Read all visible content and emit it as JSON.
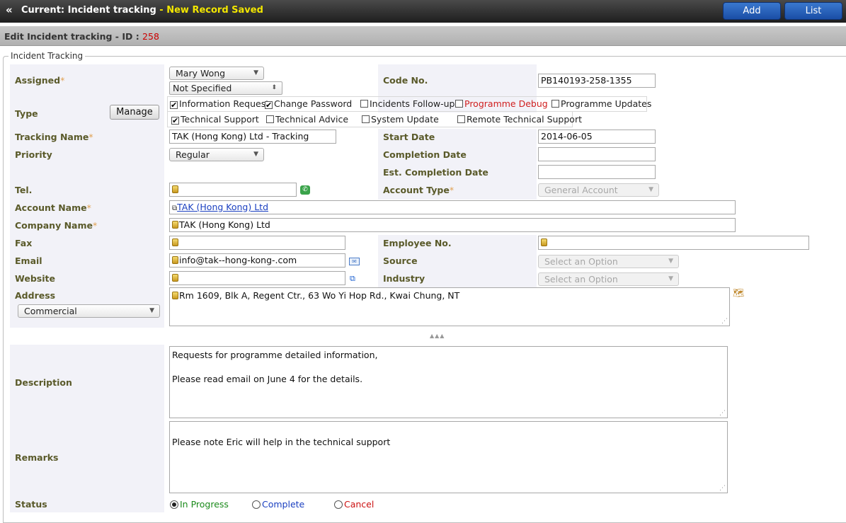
{
  "header": {
    "title": "Current: Incident tracking",
    "saved_message": " - New Record Saved",
    "add_label": "Add",
    "list_label": "List"
  },
  "subheader": {
    "label": "Edit Incident tracking - ID : ",
    "id": "258"
  },
  "fieldset": {
    "legend": "Incident Tracking"
  },
  "labels": {
    "assigned": "Assigned",
    "code_no": "Code No.",
    "type": "Type",
    "tracking_name": "Tracking Name",
    "start_date": "Start Date",
    "priority": "Priority",
    "completion_date": "Completion Date",
    "est_completion_date": "Est. Completion Date",
    "tel": "Tel.",
    "account_type": "Account Type",
    "account_name": "Account Name",
    "company_name": "Company Name",
    "fax": "Fax",
    "employee_no": "Employee No.",
    "email": "Email",
    "source": "Source",
    "website": "Website",
    "industry": "Industry",
    "address": "Address",
    "description": "Description",
    "remarks": "Remarks",
    "status": "Status",
    "required_mark": "*"
  },
  "fields": {
    "assigned_user": "Mary Wong",
    "assigned_group": "Not Specified",
    "code_no": "PB140193-258-1355",
    "tracking_name": "TAK (Hong Kong) Ltd - Tracking",
    "start_date": "2014-06-05",
    "priority": "Regular",
    "completion_date": "",
    "est_completion_date": "",
    "tel": "",
    "account_type": "General Account",
    "account_name": "TAK (Hong Kong) Ltd",
    "company_name": "TAK (Hong Kong) Ltd",
    "fax": "",
    "employee_no": "",
    "email": "info@tak--hong-kong-.com",
    "source_placeholder": "Select an Option",
    "website": "",
    "industry_placeholder": "Select an Option",
    "address_type": "Commercial",
    "address": "Rm 1609, Blk A, Regent Ctr., 63 Wo Yi Hop Rd., Kwai Chung, NT",
    "description": "Requests for programme detailed information,\n\nPlease read email on June 4 for the details.",
    "remarks": "\nPlease note Eric will help in the technical support"
  },
  "type_manage_label": "Manage",
  "type_options": [
    {
      "label": "Information Request",
      "checked": true
    },
    {
      "label": "Change Password",
      "checked": true
    },
    {
      "label": "Incidents Follow-up",
      "checked": false
    },
    {
      "label": "Programme Debug",
      "checked": false,
      "color": "#d02020"
    },
    {
      "label": "Programme Updates",
      "checked": false
    },
    {
      "label": "Technical Support",
      "checked": true
    },
    {
      "label": "Technical Advice",
      "checked": false
    },
    {
      "label": "System Update",
      "checked": false
    },
    {
      "label": "Remote Technical Support",
      "checked": false
    }
  ],
  "status_options": [
    {
      "label": "In Progress",
      "selected": true,
      "color": "#1a8a1a"
    },
    {
      "label": "Complete",
      "selected": false,
      "color": "#1a3fc0"
    },
    {
      "label": "Cancel",
      "selected": false,
      "color": "#cc1111"
    }
  ],
  "icons": {
    "back": "double-chevron-left-icon",
    "phone": "phone-icon",
    "mail": "mail-icon",
    "open_link": "external-link-icon",
    "map": "map-icon",
    "collapse": "collapse-arrows-icon",
    "lock": "lock-icon"
  },
  "colors": {
    "accent_button": "#1a4ea6",
    "saved_message": "#f2e600",
    "record_id": "#cc0000"
  }
}
